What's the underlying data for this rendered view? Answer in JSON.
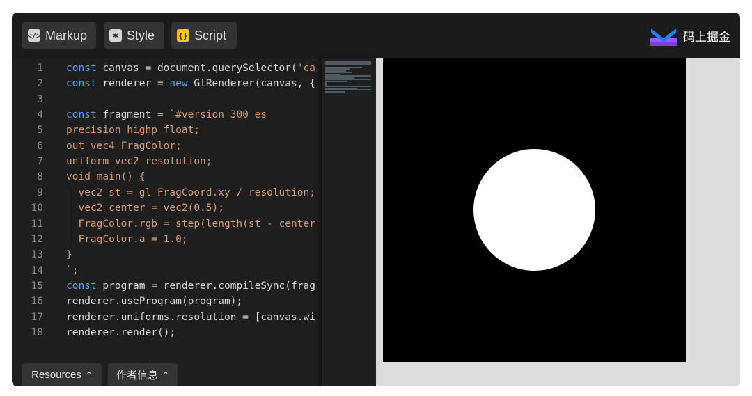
{
  "header": {
    "tabs": [
      {
        "label": "Markup",
        "icon": "code-tag-icon",
        "glyph": "</>"
      },
      {
        "label": "Style",
        "icon": "asterisk-icon",
        "glyph": "✱"
      },
      {
        "label": "Script",
        "icon": "braces-icon",
        "glyph": "{}"
      }
    ],
    "brand": {
      "name": "码上掘金",
      "icon": "juejin-logo-icon",
      "accent": "#1e80ff",
      "accent2": "#9b59ff"
    }
  },
  "editor": {
    "line_numbers": [
      "1",
      "2",
      "3",
      "4",
      "5",
      "6",
      "7",
      "8",
      "9",
      "10",
      "11",
      "12",
      "13",
      "14",
      "15",
      "16",
      "17",
      "18"
    ],
    "lines": [
      [
        {
          "t": "const",
          "c": "kw"
        },
        {
          "t": " canvas = document.querySelector(",
          "c": "pl"
        },
        {
          "t": "'ca",
          "c": "st"
        }
      ],
      [
        {
          "t": "const",
          "c": "kw"
        },
        {
          "t": " renderer = ",
          "c": "pl"
        },
        {
          "t": "new",
          "c": "kw"
        },
        {
          "t": " GlRenderer(canvas, {",
          "c": "pl"
        }
      ],
      [],
      [
        {
          "t": "const",
          "c": "kw"
        },
        {
          "t": " fragment = ",
          "c": "pl"
        },
        {
          "t": "`#version 300 es",
          "c": "st"
        }
      ],
      [
        {
          "t": "precision highp float;",
          "c": "st"
        }
      ],
      [
        {
          "t": "out vec4 FragColor;",
          "c": "st"
        }
      ],
      [
        {
          "t": "uniform vec2 resolution;",
          "c": "st"
        }
      ],
      [
        {
          "t": "void main() {",
          "c": "st"
        }
      ],
      [
        {
          "t": "  vec2 st = gl_FragCoord.xy / resolution;",
          "c": "st"
        }
      ],
      [
        {
          "t": "  vec2 center = vec2(0.5);",
          "c": "st"
        }
      ],
      [
        {
          "t": "  FragColor.rgb = step(length(st - center",
          "c": "st"
        }
      ],
      [
        {
          "t": "  FragColor.a = 1.0;",
          "c": "st"
        }
      ],
      [
        {
          "t": "}",
          "c": "st"
        }
      ],
      [
        {
          "t": "`",
          "c": "st"
        },
        {
          "t": ";",
          "c": "pl"
        }
      ],
      [
        {
          "t": "const",
          "c": "kw"
        },
        {
          "t": " program = renderer.compileSync(frag",
          "c": "pl"
        }
      ],
      [
        {
          "t": "renderer.useProgram(program);",
          "c": "pl"
        }
      ],
      [
        {
          "t": "renderer.uniforms.resolution = [canvas.wi",
          "c": "pl"
        }
      ],
      [
        {
          "t": "renderer.render();",
          "c": "pl"
        }
      ]
    ],
    "colors": {
      "kw": "#5aa0ea",
      "pl": "#d8d8d8",
      "st": "#d79b72"
    }
  },
  "footer": {
    "resources_label": "Resources",
    "author_label": "作者信息",
    "chevron": "⌃"
  },
  "preview": {
    "shape": "white-circle-on-black"
  }
}
